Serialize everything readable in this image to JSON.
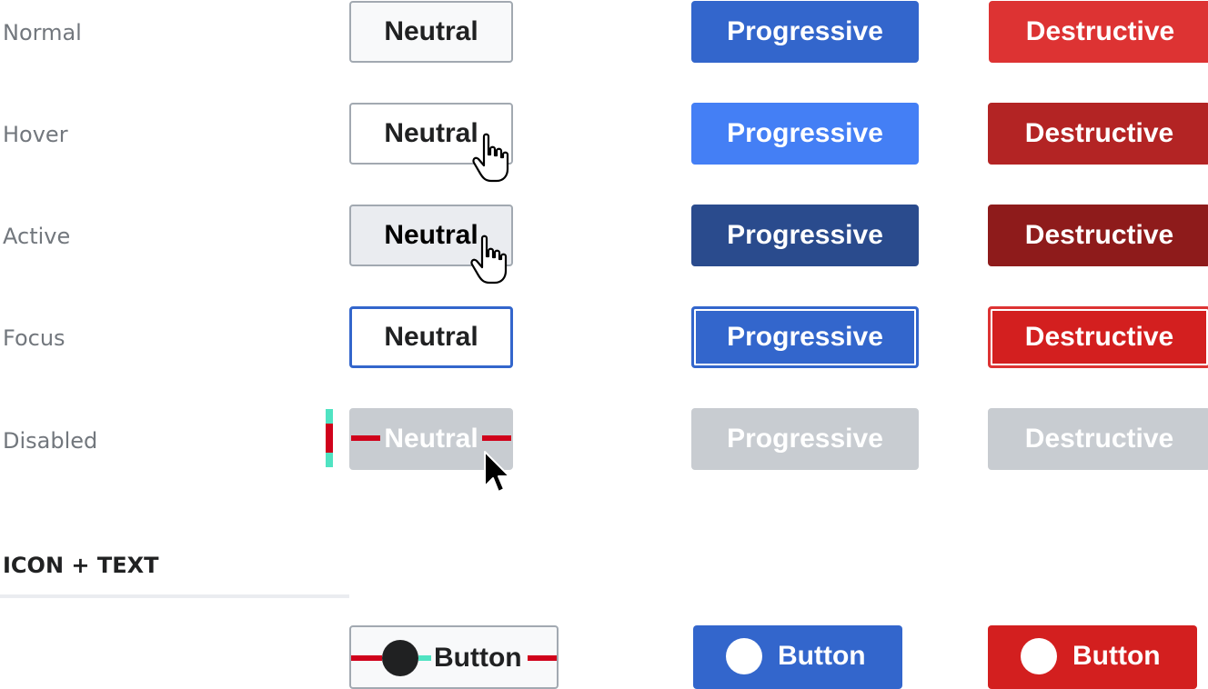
{
  "rows": [
    {
      "label": "Normal",
      "neutral": "Neutral",
      "progressive": "Progressive",
      "destructive": "Destructive"
    },
    {
      "label": "Hover",
      "neutral": "Neutral",
      "progressive": "Progressive",
      "destructive": "Destructive"
    },
    {
      "label": "Active",
      "neutral": "Neutral",
      "progressive": "Progressive",
      "destructive": "Destructive"
    },
    {
      "label": "Focus",
      "neutral": "Neutral",
      "progressive": "Progressive",
      "destructive": "Destructive"
    },
    {
      "label": "Disabled",
      "neutral": "Neutral",
      "progressive": "Progressive",
      "destructive": "Destructive"
    }
  ],
  "icon_text_section": {
    "title": "ICON + TEXT",
    "buttons": [
      {
        "label": "Button",
        "icon": "circle-icon",
        "variant": "neutral"
      },
      {
        "label": "Button",
        "icon": "circle-icon",
        "variant": "progressive"
      },
      {
        "label": "Button",
        "icon": "circle-icon",
        "variant": "destructive"
      }
    ]
  },
  "colors": {
    "progressive": "#3366cc",
    "progressive_hover": "#447ff5",
    "progressive_active": "#2a4b8d",
    "destructive": "#dd3333",
    "destructive_hover": "#b32424",
    "destructive_active": "#8e1b1b",
    "disabled": "#c8ccd1",
    "label": "#72777d",
    "spec_red": "#d0021b",
    "spec_teal": "#50e3c2"
  }
}
